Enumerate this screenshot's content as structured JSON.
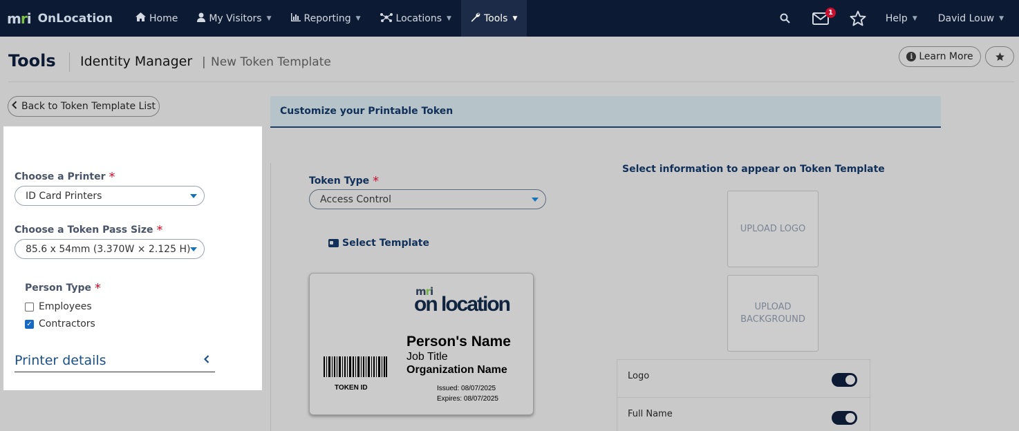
{
  "brand": {
    "logo_text": "mri",
    "name": "OnLocation"
  },
  "nav": {
    "items": [
      {
        "label": "Home",
        "icon": "home-icon"
      },
      {
        "label": "My Visitors",
        "icon": "user-icon"
      },
      {
        "label": "Reporting",
        "icon": "chart-icon"
      },
      {
        "label": "Locations",
        "icon": "network-icon"
      },
      {
        "label": "Tools",
        "icon": "wrench-icon"
      }
    ],
    "notification_count": "1",
    "help_label": "Help",
    "user_name": "David Louw"
  },
  "header": {
    "title": "Tools",
    "crumb_main": "Identity Manager",
    "crumb_separator": "|",
    "crumb_sub": "New Token Template",
    "learn_more_label": "Learn More"
  },
  "back_button_label": "Back to Token Template List",
  "left_panel": {
    "printer_label": "Choose a Printer",
    "printer_value": "ID Card Printers",
    "pass_size_label": "Choose a Token Pass Size",
    "pass_size_value": "85.6 x 54mm (3.370W × 2.125 H)",
    "person_type_label": "Person Type",
    "person_types": [
      {
        "label": "Employees",
        "checked": false
      },
      {
        "label": "Contractors",
        "checked": true
      }
    ],
    "printer_details_label": "Printer details"
  },
  "required_marker": "*",
  "customize": {
    "banner_title": "Customize your Printable Token",
    "token_type_label": "Token Type",
    "token_type_value": "Access Control",
    "select_template_label": "Select Template",
    "select_info_title": "Select information to appear on Token Template",
    "upload_logo_label": "UPLOAD LOGO",
    "upload_background_label": "UPLOAD BACKGROUND"
  },
  "token_preview": {
    "logo_mri": "mri",
    "logo_name": "on location",
    "person_name": "Person's Name",
    "job_title": "Job Title",
    "organization": "Organization Name",
    "issued": "Issued:  08/07/2025",
    "expires": "Expires: 08/07/2025",
    "token_id_label": "TOKEN ID"
  },
  "toggles": [
    {
      "label": "Logo",
      "on": true
    },
    {
      "label": "Full Name",
      "on": true
    }
  ],
  "colors": {
    "navbar": "#0c1a33",
    "accent_blue": "#1473b8",
    "required_red": "#c8102e",
    "badge_red": "#c8102e"
  }
}
